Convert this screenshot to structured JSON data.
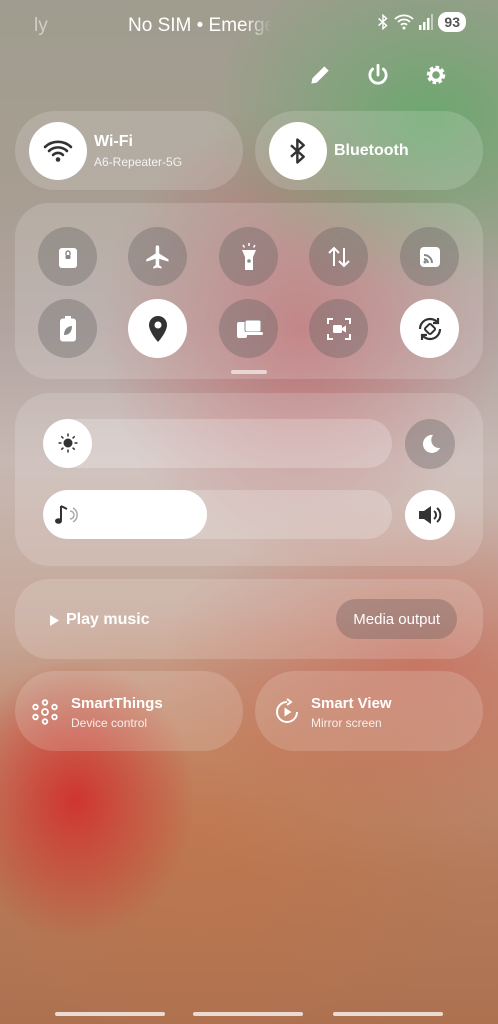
{
  "status_bar": {
    "left_text": "ly",
    "carrier": "No SIM • Emergency",
    "battery": "93",
    "icons": [
      "bluetooth-icon",
      "wifi-calling-icon",
      "signal-icon"
    ]
  },
  "top_actions": [
    "edit-icon",
    "power-icon",
    "settings-icon"
  ],
  "wifi": {
    "label": "Wi-Fi",
    "network": "A6-Repeater-5G",
    "state": "on"
  },
  "bluetooth": {
    "label": "Bluetooth",
    "state": "on"
  },
  "quick_toggles": [
    {
      "name": "secure-folder",
      "icon": "lock-folder-icon",
      "state": "off"
    },
    {
      "name": "airplane-mode",
      "icon": "airplane-icon",
      "state": "off"
    },
    {
      "name": "flashlight",
      "icon": "flashlight-icon",
      "state": "off"
    },
    {
      "name": "mobile-data",
      "icon": "data-arrows-icon",
      "state": "off"
    },
    {
      "name": "cast",
      "icon": "cast-icon",
      "state": "off"
    },
    {
      "name": "power-saving",
      "icon": "leaf-battery-icon",
      "state": "off"
    },
    {
      "name": "location",
      "icon": "location-pin-icon",
      "state": "on"
    },
    {
      "name": "link-to-windows",
      "icon": "link-devices-icon",
      "state": "off"
    },
    {
      "name": "screen-recorder",
      "icon": "screen-recorder-icon",
      "state": "off"
    },
    {
      "name": "auto-rotate",
      "icon": "rotate-icon",
      "state": "on"
    }
  ],
  "brightness": {
    "level": 0.05,
    "icon": "sun-icon",
    "dark_mode_icon": "moon-icon"
  },
  "volume": {
    "level": 0.47,
    "icon": "music-note-icon",
    "sound_mode_icon": "speaker-icon"
  },
  "media": {
    "play_label": "Play music",
    "output_label": "Media output"
  },
  "smartthings": {
    "title": "SmartThings",
    "subtitle": "Device control"
  },
  "smartview": {
    "title": "Smart View",
    "subtitle": "Mirror screen"
  },
  "colors": {
    "icon_dark": "#3a3a3a",
    "panel": "rgba(255,255,255,0.16)"
  }
}
